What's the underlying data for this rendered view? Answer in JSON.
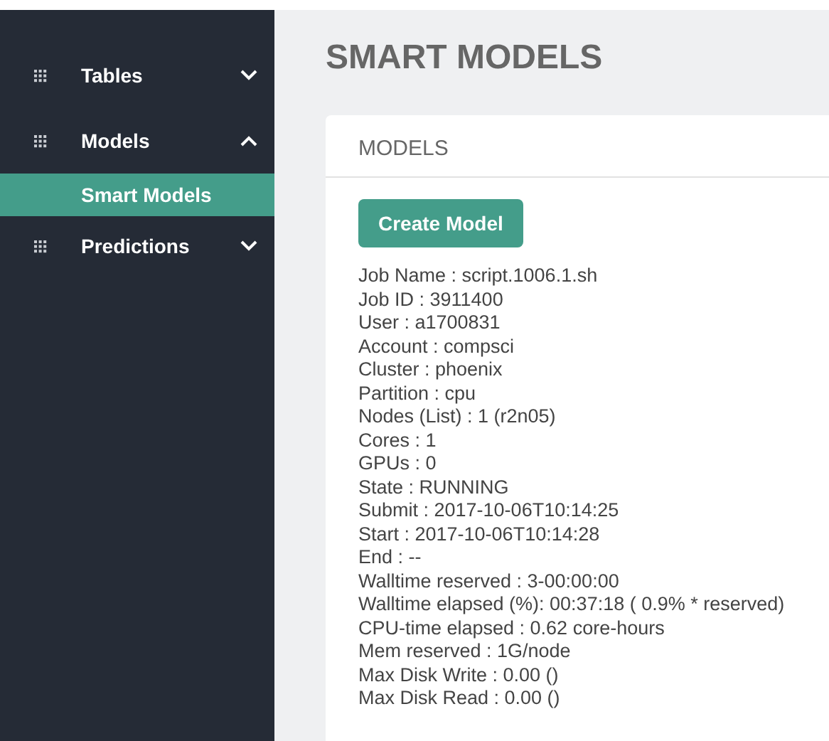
{
  "sidebar": {
    "items": [
      {
        "label": "Tables",
        "expanded": false
      },
      {
        "label": "Models",
        "expanded": true,
        "children": [
          {
            "label": "Smart Models",
            "selected": true
          }
        ]
      },
      {
        "label": "Predictions",
        "expanded": false
      }
    ]
  },
  "page_title": "SMART MODELS",
  "card": {
    "title": "MODELS",
    "button": "Create Model",
    "lines": [
      "Job Name : script.1006.1.sh",
      "Job ID : 3911400",
      "User : a1700831",
      "Account : compsci",
      "Cluster : phoenix",
      "Partition : cpu",
      "Nodes (List) : 1 (r2n05)",
      "Cores : 1",
      "GPUs : 0",
      "State : RUNNING",
      "Submit : 2017-10-06T10:14:25",
      "Start : 2017-10-06T10:14:28",
      "End : --",
      "Walltime reserved : 3-00:00:00",
      "Walltime elapsed (%): 00:37:18 ( 0.9% * reserved)",
      "CPU-time elapsed : 0.62 core-hours",
      "Mem reserved : 1G/node",
      "Max Disk Write : 0.00 ()",
      "Max Disk Read : 0.00 ()"
    ]
  }
}
